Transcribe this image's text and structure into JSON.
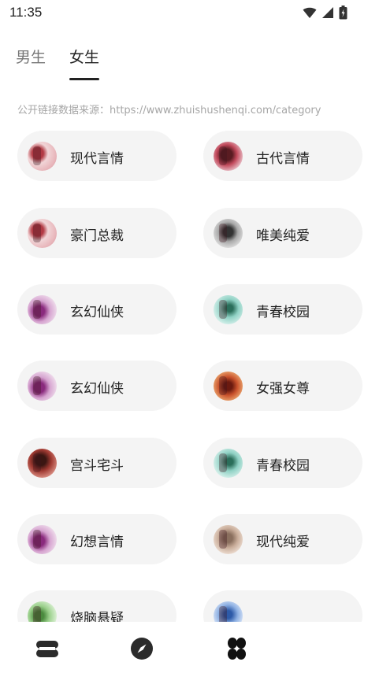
{
  "status_bar": {
    "time": "11:35",
    "icons": [
      "wifi-icon",
      "signal-icon",
      "battery-icon"
    ]
  },
  "tabs": [
    {
      "label": "男生",
      "active": false
    },
    {
      "label": "女生",
      "active": true
    }
  ],
  "source_text": "公开链接数据来源：https://www.zhuishushenqi.com/category",
  "categories": [
    {
      "label": "现代言情"
    },
    {
      "label": "古代言情"
    },
    {
      "label": "豪门总裁"
    },
    {
      "label": "唯美纯爱"
    },
    {
      "label": "玄幻仙侠"
    },
    {
      "label": "青春校园"
    },
    {
      "label": "玄幻仙侠"
    },
    {
      "label": "女强女尊"
    },
    {
      "label": "宫斗宅斗"
    },
    {
      "label": "青春校园"
    },
    {
      "label": "幻想言情"
    },
    {
      "label": "现代纯爱"
    },
    {
      "label": "烧脑悬疑"
    },
    {
      "label": ""
    }
  ],
  "bottom_nav": [
    {
      "name": "bookshelf-icon",
      "active": false
    },
    {
      "name": "compass-icon",
      "active": false
    },
    {
      "name": "category-icon",
      "active": true
    }
  ],
  "colors": {
    "background": "#ffffff",
    "card": "#f4f4f4",
    "text": "#222222",
    "muted": "#a6a6a6",
    "icon": "#2b2b2b"
  }
}
